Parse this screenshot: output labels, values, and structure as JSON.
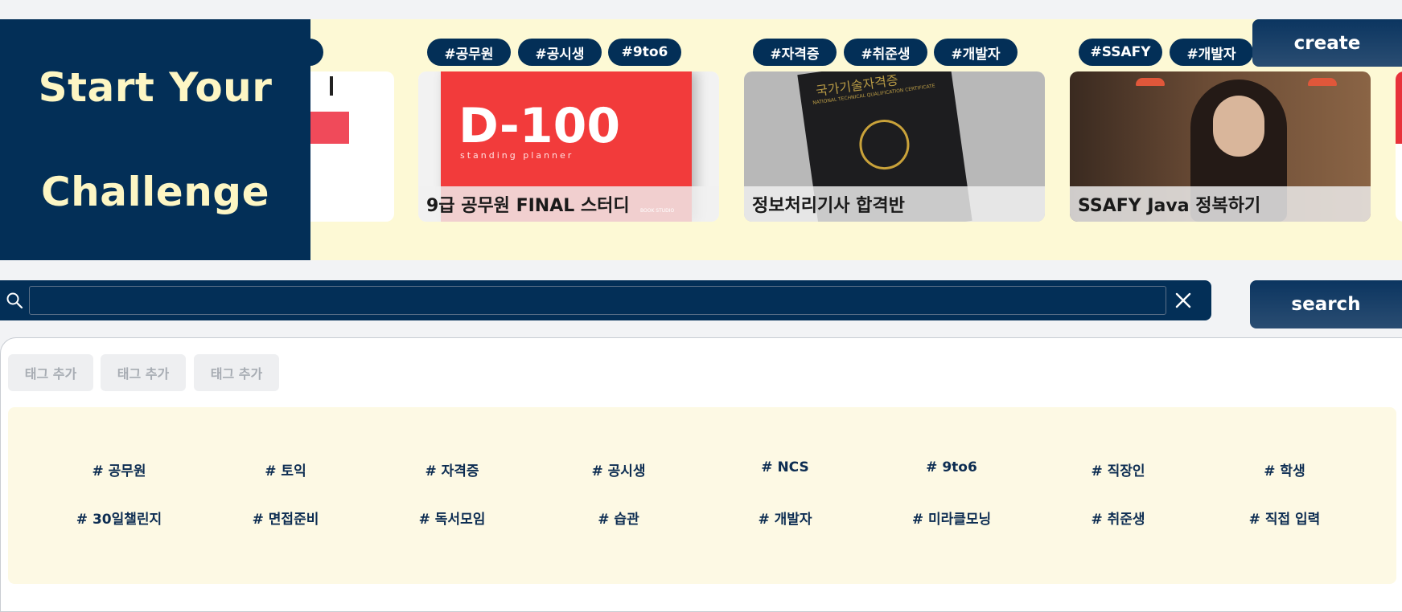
{
  "hero": {
    "title_line1": "Start Your",
    "title_line2": "Challenge",
    "create_label": "create"
  },
  "cards": [
    {
      "tags": [
        "#공무원",
        "#공시생",
        "#9to6"
      ],
      "title": "9급 공무원 FINAL 스터디",
      "image_text": "D-100",
      "image_subtext": "standing planner",
      "image_brand": "BOOK STUDIO"
    },
    {
      "tags": [
        "#자격증",
        "#취준생",
        "#개발자"
      ],
      "title": "정보처리기사 합격반",
      "image_text": "국가기술자격증",
      "image_subtext": "NATIONAL TECHNICAL QUALIFICATION CERTIFICATE"
    },
    {
      "tags": [
        "#SSAFY",
        "#개발자"
      ],
      "title": "SSAFY Java 정복하기"
    }
  ],
  "search": {
    "value": "",
    "button_label": "search"
  },
  "add_tags": [
    "태그 추가",
    "태그 추가",
    "태그 추가"
  ],
  "tag_grid": [
    "# 공무원",
    "# 토익",
    "# 자격증",
    "# 공시생",
    "# NCS",
    "# 9to6",
    "# 직장인",
    "# 학생",
    "# 30일챌린지",
    "# 면접준비",
    "# 독서모임",
    "# 습관",
    "# 개발자",
    "# 미라클모닝",
    "# 취준생",
    "# 직접 입력"
  ]
}
